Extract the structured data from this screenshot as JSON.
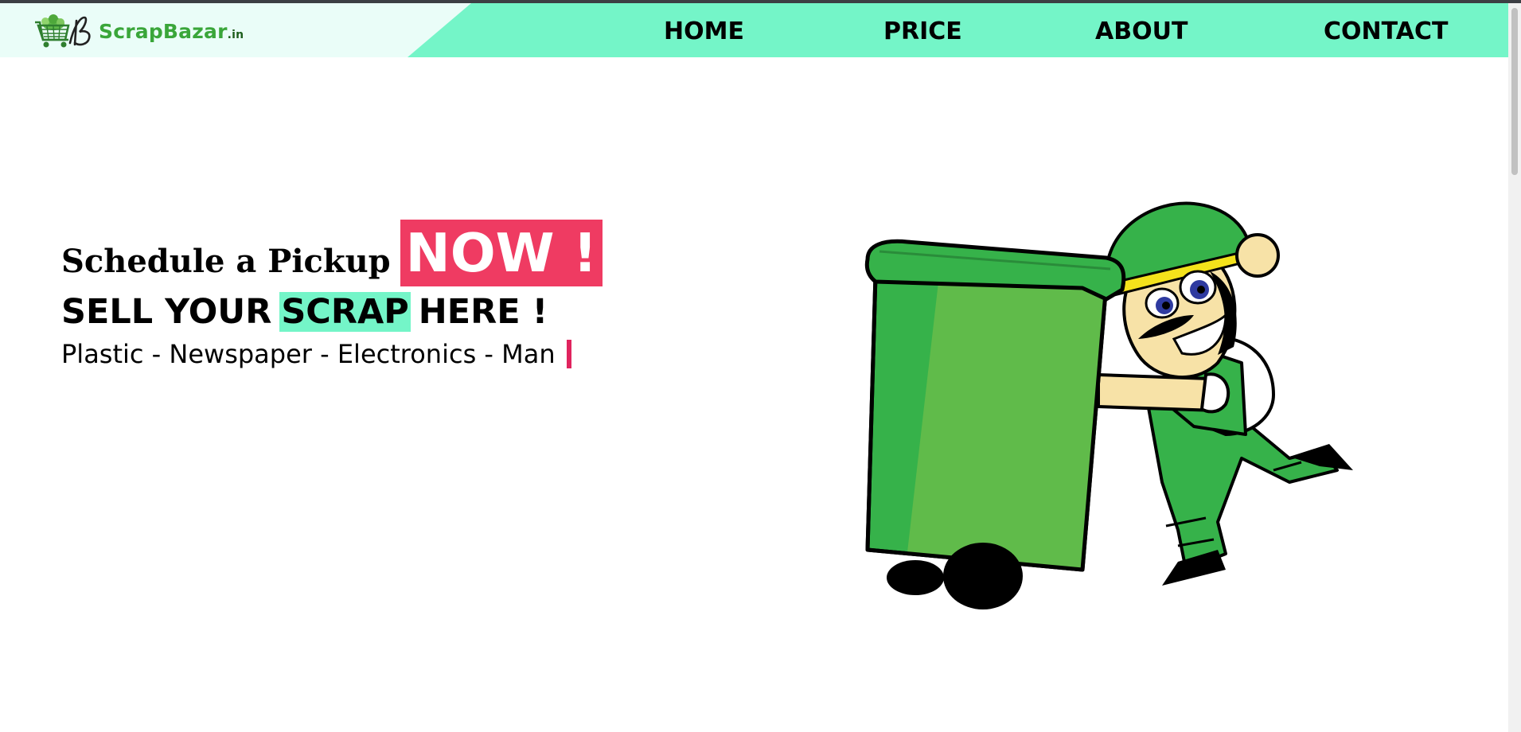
{
  "brand": {
    "name": "ScrapBazar",
    "tld": ".in",
    "logo_icon": "shopping-cart-logo-icon",
    "colors": {
      "primary": "#74f5c8",
      "accent": "#ef3b62",
      "brand_green": "#3aa63a"
    }
  },
  "nav": {
    "home": "HOME",
    "price": "PRICE",
    "about": "ABOUT",
    "contact": "CONTACT"
  },
  "hero": {
    "schedule": "Schedule a Pickup",
    "now": "NOW !",
    "sell_prefix": "SELL YOUR",
    "sell_highlight": "SCRAP",
    "sell_suffix": "HERE !",
    "typing_text": "Plastic - Newspaper - Electronics - Man"
  },
  "illustration": {
    "icon": "scrap-collector-with-bin-illustration"
  }
}
